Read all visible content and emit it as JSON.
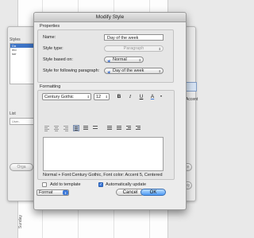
{
  "background": {
    "styles_label": "Styles",
    "style_list": [
      "Da",
      "mo",
      "sur"
    ],
    "list_label": "List",
    "list_select": "User-",
    "accent_text": "Accent",
    "organize_button": "Orga",
    "delete_button": "elete",
    "apply_button": "Apply",
    "side_label": "Sunday"
  },
  "dialog": {
    "title": "Modify Style",
    "properties_label": "Properties",
    "name_label": "Name:",
    "name_value": "Day of the week",
    "style_type_label": "Style type:",
    "style_type_value": "Paragraph",
    "based_on_label": "Style based on:",
    "based_on_value": "Normal",
    "following_label": "Style for following paragraph:",
    "following_value": "Day of the week",
    "formatting_label": "Formatting",
    "font_value": "Century Gothic",
    "size_value": "12",
    "bold": "B",
    "italic": "I",
    "underline": "U",
    "font_color": "A",
    "description": "Normal + Font:Century Gothic, Font color: Accent 5, Centered",
    "add_to_template_label": "Add to template",
    "auto_update_label": "Automatically update",
    "format_menu": "Format",
    "cancel_button": "Cancel",
    "ok_button": "OK"
  },
  "state": {
    "add_to_template": false,
    "auto_update": true
  },
  "colors": {
    "accent": "#3b78d8",
    "default_button": "#4d9af5",
    "selection": "#3d74c7"
  }
}
